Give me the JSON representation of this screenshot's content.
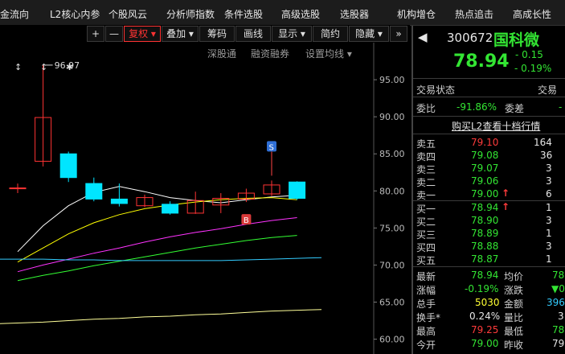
{
  "topmenu": {
    "items": [
      "金流向",
      "L2核心内参",
      "个股风云",
      "分析师指数",
      "条件选股",
      "高级选股",
      "选股器",
      "机构增仓",
      "热点追击",
      "高成长性"
    ]
  },
  "toolbar": {
    "plus": "+",
    "minus": "—",
    "fuquan": "复权",
    "diejia": "叠加",
    "chouma": "筹码",
    "huaxian": "画线",
    "xianshi": "显示",
    "jianyue": "简约",
    "yincang": "隐藏",
    "expand": "»"
  },
  "subbar": {
    "shengutong": "深股通",
    "rongzi": "融资融券",
    "shezhi": "设置均线"
  },
  "quote": {
    "code": "300672",
    "name": "国科微",
    "price": "78.94",
    "change": "- 0.15",
    "change_pct": "- 0.19%"
  },
  "status": {
    "label": "交易状态",
    "right": "交易"
  },
  "weibi": {
    "label": "委比",
    "value": "-91.86%",
    "label2": "委差",
    "value2": "-"
  },
  "l2_link": "购买L2查看十档行情",
  "sell": [
    {
      "label": "卖五",
      "price": "79.10",
      "vol": "164",
      "arrow": ""
    },
    {
      "label": "卖四",
      "price": "79.08",
      "vol": "36",
      "arrow": ""
    },
    {
      "label": "卖三",
      "price": "79.07",
      "vol": "3",
      "arrow": ""
    },
    {
      "label": "卖二",
      "price": "79.06",
      "vol": "3",
      "arrow": ""
    },
    {
      "label": "卖一",
      "price": "79.00",
      "vol": "6",
      "arrow": "↑"
    }
  ],
  "buy": [
    {
      "label": "买一",
      "price": "78.94",
      "vol": "1",
      "arrow": "↑"
    },
    {
      "label": "买二",
      "price": "78.90",
      "vol": "3",
      "arrow": ""
    },
    {
      "label": "买三",
      "price": "78.89",
      "vol": "1",
      "arrow": ""
    },
    {
      "label": "买四",
      "price": "78.88",
      "vol": "3",
      "arrow": ""
    },
    {
      "label": "买五",
      "price": "78.87",
      "vol": "1",
      "arrow": ""
    }
  ],
  "stats": {
    "zuixin": {
      "label": "最新",
      "value": "78.94"
    },
    "junjia": {
      "label": "均价",
      "value": "78"
    },
    "zhangfu": {
      "label": "涨幅",
      "value": "-0.19%"
    },
    "zhangdie": {
      "label": "涨跌",
      "value": "▼0"
    },
    "zongshou": {
      "label": "总手",
      "value": "5030"
    },
    "jine": {
      "label": "金额",
      "value": "396"
    },
    "huanshou": {
      "label": "换手*",
      "value": "0.24%"
    },
    "liangbi": {
      "label": "量比",
      "value": "3"
    },
    "zuigao": {
      "label": "最高",
      "value": "79.25"
    },
    "zuidi": {
      "label": "最低",
      "value": "78"
    },
    "jinkai": {
      "label": "今开",
      "value": "79.00"
    },
    "zuoshou": {
      "label": "昨收",
      "value": "79"
    }
  },
  "colors": {
    "up": "#ff3333",
    "down": "#00e5ff",
    "ma5": "#ffffff",
    "ma10": "#ffff00",
    "ma20": "#ff33ff",
    "ma30": "#33ff33",
    "ma60": "#33ccff",
    "ma120": "#ffff99"
  },
  "chart_data": {
    "type": "candlestick",
    "ylim": [
      58.0,
      100.0
    ],
    "y_ticks": [
      60.0,
      65.0,
      70.0,
      75.0,
      80.0,
      85.0,
      90.0,
      95.0
    ],
    "y_tick_labels": [
      "60.00",
      "65.00",
      "70.00",
      "75.00",
      "80.00",
      "85.00",
      "90.00",
      "95.00"
    ],
    "high_label": "96.97",
    "top_markers": [
      "↕",
      "↕",
      "✱"
    ],
    "signals": [
      {
        "label": "S",
        "candle": 10
      },
      {
        "label": "B",
        "candle": 9
      }
    ],
    "candles": [
      {
        "open": 80.4,
        "close": 80.4,
        "high": 81.0,
        "low": 79.7
      },
      {
        "open": 84.0,
        "close": 89.9,
        "high": 96.97,
        "low": 83.3
      },
      {
        "open": 85.0,
        "close": 81.8,
        "high": 85.3,
        "low": 81.2
      },
      {
        "open": 81.0,
        "close": 78.9,
        "high": 81.8,
        "low": 78.6
      },
      {
        "open": 78.9,
        "close": 78.3,
        "high": 81.0,
        "low": 77.9
      },
      {
        "open": 78.0,
        "close": 79.1,
        "high": 79.5,
        "low": 77.8
      },
      {
        "open": 78.2,
        "close": 77.0,
        "high": 78.6,
        "low": 76.8
      },
      {
        "open": 77.0,
        "close": 78.7,
        "high": 79.9,
        "low": 76.9
      },
      {
        "open": 78.1,
        "close": 79.0,
        "high": 79.7,
        "low": 77.0
      },
      {
        "open": 78.9,
        "close": 79.7,
        "high": 80.3,
        "low": 78.5
      },
      {
        "open": 79.6,
        "close": 80.8,
        "high": 81.4,
        "low": 79.3
      },
      {
        "open": 81.2,
        "close": 79.0,
        "high": 81.3,
        "low": 78.8
      }
    ],
    "series": [
      {
        "name": "MA5",
        "values": [
          71.8,
          75.3,
          78.0,
          79.8,
          80.6,
          79.9,
          79.1,
          78.7,
          78.4,
          78.8,
          79.2,
          79.4
        ]
      },
      {
        "name": "MA10",
        "values": [
          70.4,
          72.3,
          74.2,
          75.7,
          76.8,
          77.6,
          78.1,
          78.5,
          78.8,
          79.0,
          79.1,
          78.8
        ]
      },
      {
        "name": "MA20",
        "values": [
          69.1,
          70.0,
          70.8,
          71.6,
          72.3,
          73.1,
          73.8,
          74.4,
          74.9,
          75.5,
          76.0,
          76.4
        ]
      },
      {
        "name": "MA30",
        "values": [
          67.9,
          68.6,
          69.2,
          69.9,
          70.5,
          71.1,
          71.7,
          72.3,
          72.8,
          73.3,
          73.7,
          74.0
        ]
      },
      {
        "name": "MA60",
        "values": [
          70.8,
          70.8,
          70.7,
          70.7,
          70.6,
          70.6,
          70.6,
          70.6,
          70.6,
          70.7,
          70.8,
          71.0
        ]
      },
      {
        "name": "MA120",
        "values": [
          62.1,
          62.3,
          62.5,
          62.7,
          62.8,
          63.0,
          63.1,
          63.3,
          63.4,
          63.6,
          63.8,
          64.0
        ]
      }
    ]
  }
}
